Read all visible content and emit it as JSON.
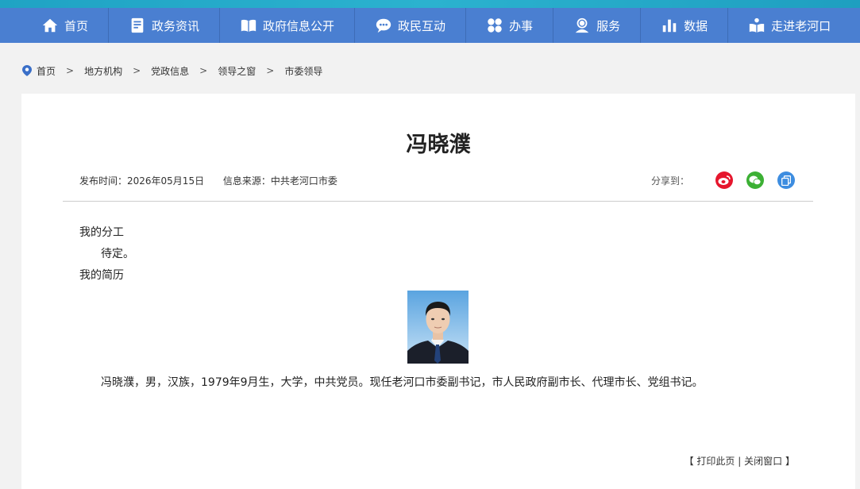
{
  "nav": [
    {
      "label": "首页",
      "icon": "home-icon"
    },
    {
      "label": "政务资讯",
      "icon": "news-icon"
    },
    {
      "label": "政府信息公开",
      "icon": "open-book-icon"
    },
    {
      "label": "政民互动",
      "icon": "chat-icon"
    },
    {
      "label": "办事",
      "icon": "grid-icon"
    },
    {
      "label": "服务",
      "icon": "service-person-icon"
    },
    {
      "label": "数据",
      "icon": "bar-chart-icon"
    },
    {
      "label": "走进老河口",
      "icon": "reading-person-icon"
    }
  ],
  "breadcrumb": [
    "首页",
    "地方机构",
    "党政信息",
    "领导之窗",
    "市委领导"
  ],
  "breadcrumb_sep": ">",
  "article": {
    "title": "冯晓濮",
    "publish_time": "发布时间：2026年05月15日",
    "source": "信息来源：中共老河口市委",
    "share_label": "分享到：",
    "section1_heading": "我的分工",
    "section1_text": "待定。",
    "section2_heading": "我的简历",
    "bio": "冯晓濮，男，汉族，1979年9月生，大学，中共党员。现任老河口市委副书记，市人民政府副市长、代理市长、党组书记。"
  },
  "footer_actions": {
    "open_bracket": "【",
    "print": "打印此页",
    "divider": "|",
    "close": "关闭窗口",
    "close_bracket": "】"
  },
  "colors": {
    "nav_bg": "#4a7fd1",
    "weibo": "#e6162d",
    "wechat": "#3cb034",
    "copy": "#3d8de0"
  }
}
